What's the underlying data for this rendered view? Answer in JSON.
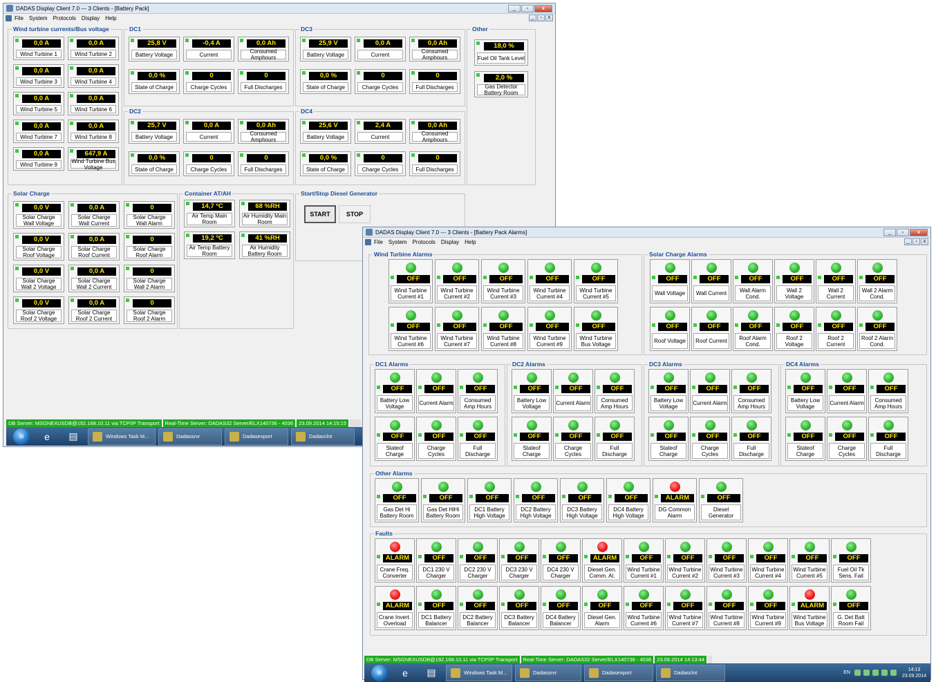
{
  "colors": {
    "accent": "#1b4d96",
    "display_bg": "#000000",
    "display_text": "#ffe700",
    "ok_indicator": "#35b535",
    "alarm_indicator": "#f21e1e",
    "status_green": "#21a821"
  },
  "menu": [
    "File",
    "System",
    "Protocols",
    "Display",
    "Help"
  ],
  "window1": {
    "title": "DADAS Display Client 7.0 --- 3 Clients - [Battery Pack]",
    "wind": {
      "title": "Wind turbine currents/Bus voltage",
      "cells": [
        {
          "value": "0,0 A",
          "label": "Wind Turbine 1"
        },
        {
          "value": "0,0 A",
          "label": "Wind Turbine 2"
        },
        {
          "value": "0,0 A",
          "label": "Wind Turbine 3"
        },
        {
          "value": "0,0 A",
          "label": "Wind Turbine 4"
        },
        {
          "value": "0,0 A",
          "label": "Wind Turbine 5"
        },
        {
          "value": "0,0 A",
          "label": "Wind Turbine 6"
        },
        {
          "value": "0,0 A",
          "label": "Wind Turbine 7"
        },
        {
          "value": "0,0 A",
          "label": "Wind Turbine 8"
        },
        {
          "value": "0,0 A",
          "label": "Wind Turbine 9"
        },
        {
          "value": "647,9 A",
          "label": "Wind Turbine Bus Voltage"
        }
      ]
    },
    "dc1": {
      "title": "DC1",
      "cells": [
        {
          "value": "25,8 V",
          "label": "Battery Voltage"
        },
        {
          "value": "-0,4 A",
          "label": "Current"
        },
        {
          "value": "0,0 Ah",
          "label": "Consumed Amphours"
        },
        {
          "value": "0,0 %",
          "label": "State of Charge"
        },
        {
          "value": "0",
          "label": "Charge Cycles"
        },
        {
          "value": "0",
          "label": "Full Discharges"
        }
      ]
    },
    "dc2": {
      "title": "DC2",
      "cells": [
        {
          "value": "25,7 V",
          "label": "Battery Voltage"
        },
        {
          "value": "0,0 A",
          "label": "Current"
        },
        {
          "value": "0,0 Ah",
          "label": "Consumed Amphours"
        },
        {
          "value": "0,0 %",
          "label": "State of Charge"
        },
        {
          "value": "0",
          "label": "Charge Cycles"
        },
        {
          "value": "0",
          "label": "Full Discharges"
        }
      ]
    },
    "dc3": {
      "title": "DC3",
      "cells": [
        {
          "value": "25,9 V",
          "label": "Battery Voltage"
        },
        {
          "value": "0,0 A",
          "label": "Current"
        },
        {
          "value": "0,0 Ah",
          "label": "Consumed Amphours"
        },
        {
          "value": "0,0 %",
          "label": "State of Charge"
        },
        {
          "value": "0",
          "label": "Charge Cycles"
        },
        {
          "value": "0",
          "label": "Full Discharges"
        }
      ]
    },
    "dc4": {
      "title": "DC4",
      "cells": [
        {
          "value": "25,6 V",
          "label": "Battery Voltage"
        },
        {
          "value": "2,4 A",
          "label": "Current"
        },
        {
          "value": "0,0 Ah",
          "label": "Consumed Amphours"
        },
        {
          "value": "0,0 %",
          "label": "State of Charge"
        },
        {
          "value": "0",
          "label": "Charge Cycles"
        },
        {
          "value": "0",
          "label": "Full Discharges"
        }
      ]
    },
    "other": {
      "title": "Other",
      "cells": [
        {
          "value": "18,0 %",
          "label": "Fuel Oil Tank Level"
        },
        {
          "value": "2,0 %",
          "label": "Gas Detector Battery Room"
        }
      ]
    },
    "solar": {
      "title": "Solar Charge",
      "cells": [
        {
          "value": "0,0 V",
          "label": "Solar Charge Wall Voltage"
        },
        {
          "value": "0,0 A",
          "label": "Solar Charge Wall Current"
        },
        {
          "value": "0",
          "label": "Solar Charge Wall Alarm"
        },
        {
          "value": "0,0 V",
          "label": "Solar Charge Roof Voltage"
        },
        {
          "value": "0,0 A",
          "label": "Solar Charge Roof Current"
        },
        {
          "value": "0",
          "label": "Solar Charge Roof Alarm"
        },
        {
          "value": "0,0 V",
          "label": "Solar Charge Wall 2 Voltage"
        },
        {
          "value": "0,0 A",
          "label": "Solar Charge Wall 2 Current"
        },
        {
          "value": "0",
          "label": "Solar Charge Wall 2 Alarm"
        },
        {
          "value": "0,0 V",
          "label": "Solar Charge Roof 2 Voltage"
        },
        {
          "value": "0,0 A",
          "label": "Solar Charge Roof 2 Current"
        },
        {
          "value": "0",
          "label": "Solar Charge Roof 2 Alarm"
        }
      ]
    },
    "container": {
      "title": "Container AT/AH",
      "cells": [
        {
          "value": "14,7 ºC",
          "label": "Air Temp Main Room"
        },
        {
          "value": "68 %RH",
          "label": "Air Humidity Main Room"
        },
        {
          "value": "19,2 ºC",
          "label": "Air Temp Battery Room"
        },
        {
          "value": "41 %RH",
          "label": "Air Humidity Battery Room"
        }
      ]
    },
    "diesel": {
      "title": "Start/Stop Diesel Generator",
      "start": "START",
      "stop": "STOP"
    },
    "status": [
      "DB Server: MSGNEXUSDB@192.168.10.11 via TCP/IP Transport",
      "Real-Time Server: DADAS32 Server/ELX140736 - 4036",
      "23.09.2014 14:15:15"
    ],
    "taskbar": [
      "Windows Task M...",
      "Dadassrvr",
      "Dadasexport",
      "Dadasclnt"
    ]
  },
  "window2": {
    "title": "DADAS Display Client 7.0 --- 3 Clients - [Battery Pack Alarms]",
    "wind_alarms": {
      "title": "Wind Turbine Alarms",
      "cells": [
        {
          "state": "OFF",
          "label": "Wind Turbine Current #1"
        },
        {
          "state": "OFF",
          "label": "Wind Turbine Current #2"
        },
        {
          "state": "OFF",
          "label": "Wind Turbine Current #3"
        },
        {
          "state": "OFF",
          "label": "Wind Turbine Current #4"
        },
        {
          "state": "OFF",
          "label": "Wind Turbine Current #5"
        },
        {
          "state": "OFF",
          "label": "Wind Turbine Current #6"
        },
        {
          "state": "OFF",
          "label": "Wind Turbine Current #7"
        },
        {
          "state": "OFF",
          "label": "Wind Turbine Current #8"
        },
        {
          "state": "OFF",
          "label": "Wind Turbine Current #9"
        },
        {
          "state": "OFF",
          "label": "Wind Turbine Bus Voltage"
        }
      ]
    },
    "solar_alarms": {
      "title": "Solar Charge Alarms",
      "cells": [
        {
          "state": "OFF",
          "label": "Wall Voltage"
        },
        {
          "state": "OFF",
          "label": "Wall Current"
        },
        {
          "state": "OFF",
          "label": "Wall Alarm Cond."
        },
        {
          "state": "OFF",
          "label": "Wall 2 Voltage"
        },
        {
          "state": "OFF",
          "label": "Wall 2 Current"
        },
        {
          "state": "OFF",
          "label": "Wall 2 Alarm Cond."
        },
        {
          "state": "OFF",
          "label": "Roof Voltage"
        },
        {
          "state": "OFF",
          "label": "Roof Current"
        },
        {
          "state": "OFF",
          "label": "Roof Alarm Cond."
        },
        {
          "state": "OFF",
          "label": "Roof 2 Voltage"
        },
        {
          "state": "OFF",
          "label": "Roof 2 Current"
        },
        {
          "state": "OFF",
          "label": "Roof 2 Alarm Cond."
        }
      ]
    },
    "dc_alarms": [
      {
        "title": "DC1 Alarms",
        "cells": [
          {
            "state": "OFF",
            "label": "Battery Low Voltage"
          },
          {
            "state": "OFF",
            "label": "Current Alarm"
          },
          {
            "state": "OFF",
            "label": "Consumed Amp Hours"
          },
          {
            "state": "OFF",
            "label": "Stateof Charge"
          },
          {
            "state": "OFF",
            "label": "Charge Cycles"
          },
          {
            "state": "OFF",
            "label": "Full Discharge"
          }
        ]
      },
      {
        "title": "DC2 Alarms",
        "cells": [
          {
            "state": "OFF",
            "label": "Battery Low Voltage"
          },
          {
            "state": "OFF",
            "label": "Current Alarm"
          },
          {
            "state": "OFF",
            "label": "Consumed Amp Hours"
          },
          {
            "state": "OFF",
            "label": "Stateof Charge"
          },
          {
            "state": "OFF",
            "label": "Charge Cycles"
          },
          {
            "state": "OFF",
            "label": "Full Discharge"
          }
        ]
      },
      {
        "title": "DC3 Alarms",
        "cells": [
          {
            "state": "OFF",
            "label": "Battery Low Voltage"
          },
          {
            "state": "OFF",
            "label": "Current Alarm"
          },
          {
            "state": "OFF",
            "label": "Consumed Amp Hours"
          },
          {
            "state": "OFF",
            "label": "Stateof Charge"
          },
          {
            "state": "OFF",
            "label": "Charge Cycles"
          },
          {
            "state": "OFF",
            "label": "Full Discharge"
          }
        ]
      },
      {
        "title": "DC4 Alarms",
        "cells": [
          {
            "state": "OFF",
            "label": "Battery Low Voltage"
          },
          {
            "state": "OFF",
            "label": "Current Alarm"
          },
          {
            "state": "OFF",
            "label": "Consumed Amp Hours"
          },
          {
            "state": "OFF",
            "label": "Stateof Charge"
          },
          {
            "state": "OFF",
            "label": "Charge Cycles"
          },
          {
            "state": "OFF",
            "label": "Full Discharge"
          }
        ]
      }
    ],
    "other_alarms": {
      "title": "Other Alarms",
      "cells": [
        {
          "state": "OFF",
          "label": "Gas Det Hi Battery Room"
        },
        {
          "state": "OFF",
          "label": "Gas Det HiHi Battery Room"
        },
        {
          "state": "OFF",
          "label": "DC1 Battery High Voltage"
        },
        {
          "state": "OFF",
          "label": "DC2 Battery High Voltage"
        },
        {
          "state": "OFF",
          "label": "DC3 Battery High Voltage"
        },
        {
          "state": "OFF",
          "label": "DC4 Battery High Voltage"
        },
        {
          "state": "ALARM",
          "label": "DG Common Alarm"
        },
        {
          "state": "OFF",
          "label": "Diesel Generator"
        }
      ]
    },
    "faults": {
      "title": "Faults",
      "cells": [
        {
          "state": "ALARM",
          "label": "Crane Freq. Converter"
        },
        {
          "state": "OFF",
          "label": "DC1 230 V Charger"
        },
        {
          "state": "OFF",
          "label": "DC2 230 V Charger"
        },
        {
          "state": "OFF",
          "label": "DC3 230 V Charger"
        },
        {
          "state": "OFF",
          "label": "DC4 230 V Charger"
        },
        {
          "state": "ALARM",
          "label": "Diesel Gen. Comm. Al."
        },
        {
          "state": "OFF",
          "label": "Wind Turbine Current #1"
        },
        {
          "state": "OFF",
          "label": "Wind Turbine Current #2"
        },
        {
          "state": "OFF",
          "label": "Wind Turbine Current #3"
        },
        {
          "state": "OFF",
          "label": "Wind Turbine Current #4"
        },
        {
          "state": "OFF",
          "label": "Wind Turbine Current #5"
        },
        {
          "state": "OFF",
          "label": "Fuel Oil Tk Sens. Fail"
        },
        {
          "state": "ALARM",
          "label": "Crane Invert. Overload"
        },
        {
          "state": "OFF",
          "label": "DC1 Battery Balancer"
        },
        {
          "state": "OFF",
          "label": "DC2 Battery Balancer"
        },
        {
          "state": "OFF",
          "label": "DC3 Battery Balancer"
        },
        {
          "state": "OFF",
          "label": "DC4 Battery Balancer"
        },
        {
          "state": "OFF",
          "label": "Diesel Gen. Alarm"
        },
        {
          "state": "OFF",
          "label": "Wind Turbine Current #6"
        },
        {
          "state": "OFF",
          "label": "Wind Turbine Current #7"
        },
        {
          "state": "OFF",
          "label": "Wind Turbine Current #8"
        },
        {
          "state": "OFF",
          "label": "Wind Turbine Current #9"
        },
        {
          "state": "ALARM",
          "label": "Wind Turbine Bus Voltage"
        },
        {
          "state": "OFF",
          "label": "G. Det Batt Room Fail"
        }
      ]
    },
    "status": [
      "DB Server: MSGNEXUSDB@192.168.10.11 via TCP/IP Transport",
      "Real-Time Server: DADAS32 Server/ELX140736 - 4036",
      "23.09.2014 14:13:44"
    ],
    "taskbar": [
      "Windows Task M...",
      "Dadassrvr",
      "Dadasexport",
      "Dadasclnt"
    ],
    "tray": {
      "lang": "EN",
      "time": "14:13",
      "date": "23.09.2014"
    }
  }
}
